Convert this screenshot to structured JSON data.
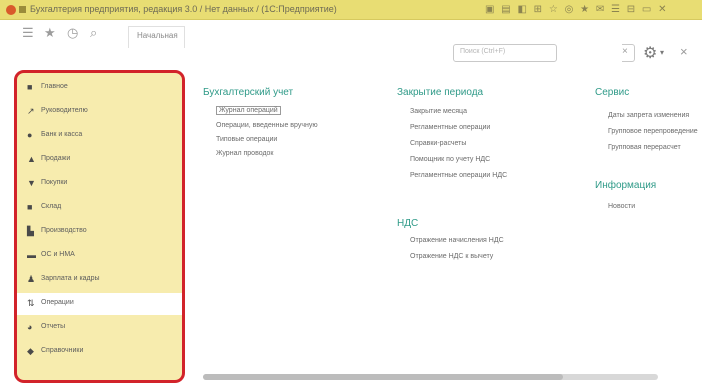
{
  "window": {
    "title": "Бухгалтерия предприятия, редакция 3.0 / Нет данных / (1С:Предприятие)"
  },
  "toolbar": {
    "tab_label": "Начальная",
    "search_placeholder": "Поиск (Ctrl+F)"
  },
  "sidebar": {
    "items": [
      {
        "label": "Главное",
        "icon": "home-icon"
      },
      {
        "label": "Руководителю",
        "icon": "chart-icon"
      },
      {
        "label": "Банк и касса",
        "icon": "bank-icon"
      },
      {
        "label": "Продажи",
        "icon": "sales-icon"
      },
      {
        "label": "Покупки",
        "icon": "cart-icon"
      },
      {
        "label": "Склад",
        "icon": "warehouse-icon"
      },
      {
        "label": "Производство",
        "icon": "factory-icon"
      },
      {
        "label": "ОС и НМА",
        "icon": "assets-icon"
      },
      {
        "label": "Зарплата и кадры",
        "icon": "people-icon"
      },
      {
        "label": "Операции",
        "icon": "operations-icon",
        "selected": true
      },
      {
        "label": "Отчеты",
        "icon": "reports-icon"
      },
      {
        "label": "Справочники",
        "icon": "book-icon"
      }
    ]
  },
  "content": {
    "col1": {
      "heading": "Бухгалтерский учет",
      "links": [
        "Журнал операций",
        "Операции, введенные вручную",
        "Типовые операции",
        "Журнал проводок"
      ]
    },
    "col2": {
      "heading": "Закрытие периода",
      "links": [
        "Закрытие месяца",
        "Регламентные операции",
        "Справки-расчеты",
        "Помощник по учету НДС",
        "Регламентные операции НДС"
      ],
      "heading2": "НДС",
      "links2": [
        "Отражение начисления НДС",
        "Отражение НДС к вычету"
      ]
    },
    "col3": {
      "heading": "Сервис",
      "links": [
        "Даты запрета изменения",
        "Групповое перепроведение",
        "Групповая перерасчет"
      ],
      "heading2": "Информация",
      "links2": [
        "Новости"
      ]
    }
  },
  "colors": {
    "titlebar": "#e8dd73",
    "sidebar_bg": "#f7ecae",
    "highlight_border": "#d2232a",
    "heading": "#2f9a88"
  }
}
